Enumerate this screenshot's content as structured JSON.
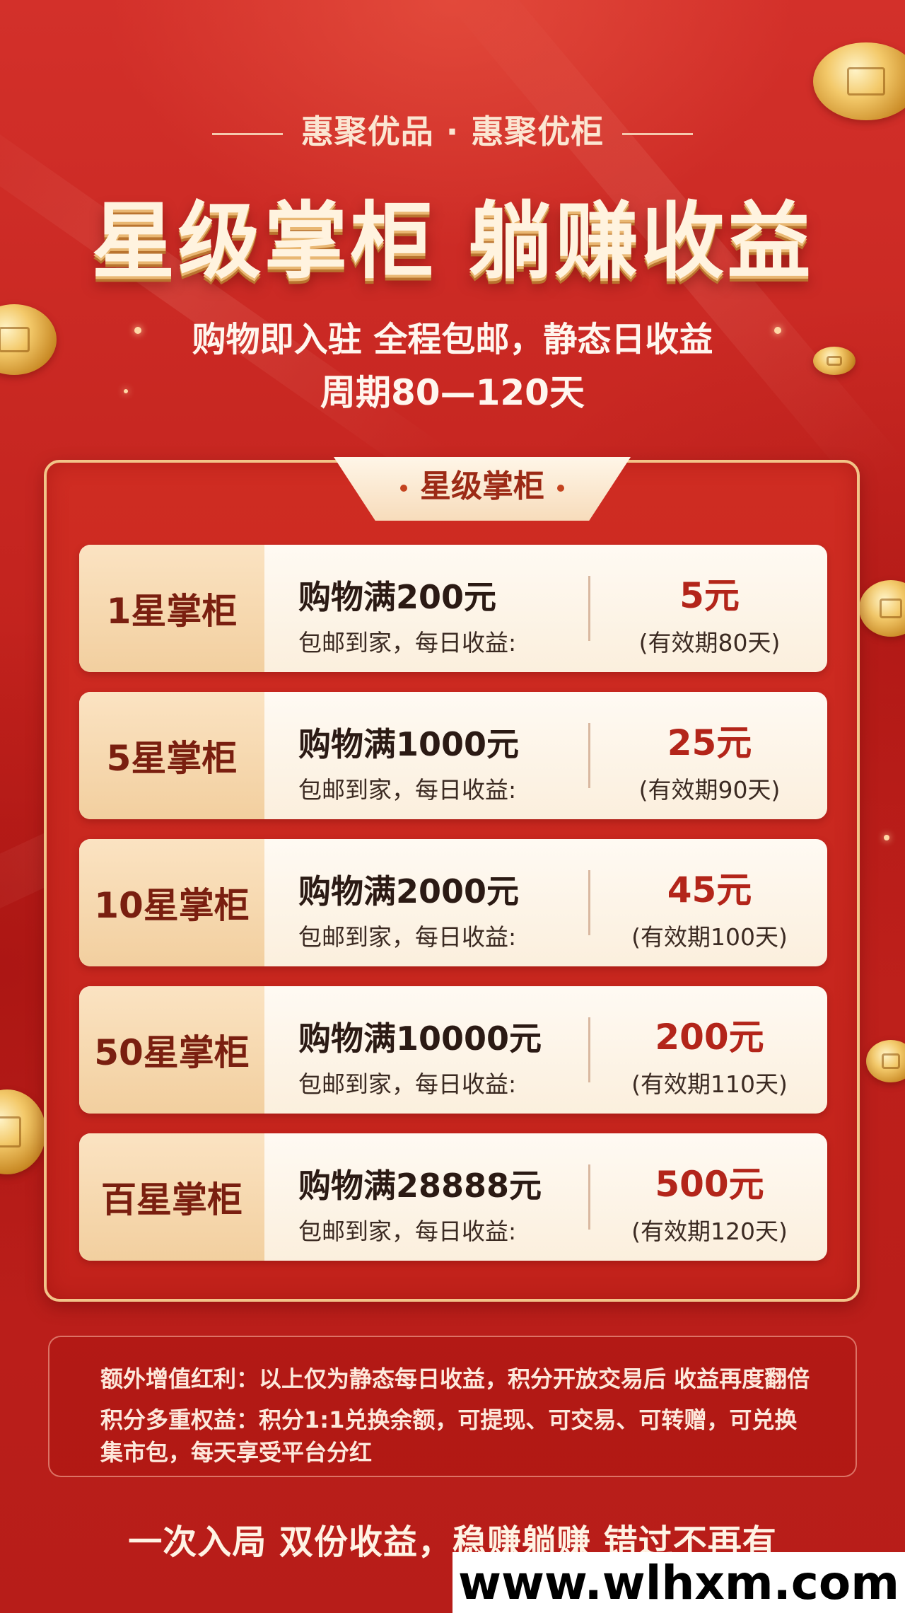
{
  "brand_line": "惠聚优品 · 惠聚优柜",
  "headline": "星级掌柜 躺赚收益",
  "subtitle_1": "购物即入驻 全程包邮，静态日收益",
  "subtitle_2": "周期80—120天",
  "panel": {
    "tab_title": "星级掌柜",
    "tiers": [
      {
        "level": "1星掌柜",
        "condition": "购物满200元",
        "desc": "包邮到家，每日收益:",
        "reward": "5元",
        "validity": "(有效期80天)"
      },
      {
        "level": "5星掌柜",
        "condition": "购物满1000元",
        "desc": "包邮到家，每日收益:",
        "reward": "25元",
        "validity": "(有效期90天)"
      },
      {
        "level": "10星掌柜",
        "condition": "购物满2000元",
        "desc": "包邮到家，每日收益:",
        "reward": "45元",
        "validity": "(有效期100天)"
      },
      {
        "level": "50星掌柜",
        "condition": "购物满10000元",
        "desc": "包邮到家，每日收益:",
        "reward": "200元",
        "validity": "(有效期110天)"
      },
      {
        "level": "百星掌柜",
        "condition": "购物满28888元",
        "desc": "包邮到家，每日收益:",
        "reward": "500元",
        "validity": "(有效期120天)"
      }
    ]
  },
  "notes": {
    "line_1": "额外增值红利：以上仅为静态每日收益，积分开放交易后 收益再度翻倍",
    "line_2": "积分多重权益：积分1:1兑换余额，可提现、可交易、可转赠，可兑换集市包，每天享受平台分红"
  },
  "footer_slogan": "一次入局 双份收益，稳赚躺赚 错过不再有",
  "watermark": "www.wlhxm.com",
  "colors": {
    "background_red": "#c6241e",
    "gold": "#f2c489",
    "reward_red": "#b3251a",
    "cream": "#fffaf3"
  }
}
